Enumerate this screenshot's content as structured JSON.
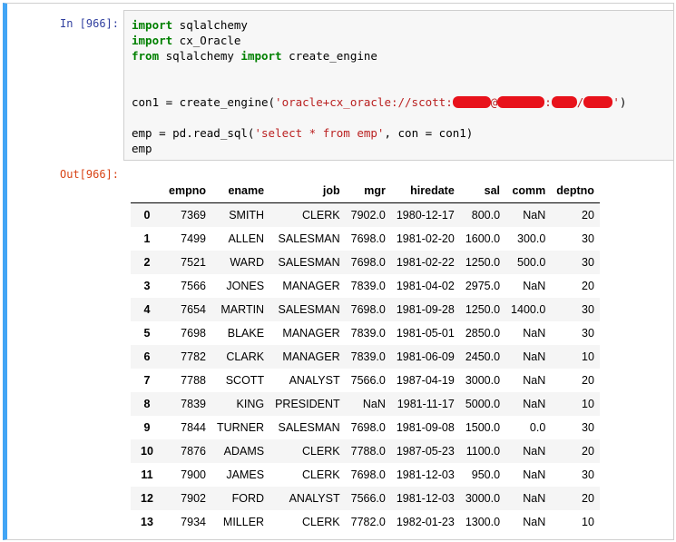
{
  "cell": {
    "in_prompt": "In [966]:",
    "out_prompt": "Out[966]:"
  },
  "code": {
    "l1_kw": "import",
    "l1_rest": " sqlalchemy",
    "l2_kw": "import",
    "l2_rest": " cx_Oracle",
    "l3_kw1": "from",
    "l3_mid": " sqlalchemy ",
    "l3_kw2": "import",
    "l3_rest": " create_engine",
    "l4_pre": "con1 = create_engine(",
    "l4_str1": "'oracle+cx_oracle://scott:",
    "l4_str2": "@",
    "l4_str3": ":",
    "l4_str4": "/",
    "l4_str5": "'",
    "l4_post": ")",
    "l5_pre": "emp = pd.read_sql(",
    "l5_str": "'select * from emp'",
    "l5_post": ", con = con1)",
    "l6": "emp"
  },
  "table": {
    "columns": [
      "",
      "empno",
      "ename",
      "job",
      "mgr",
      "hiredate",
      "sal",
      "comm",
      "deptno"
    ],
    "rows": [
      [
        "0",
        "7369",
        "SMITH",
        "CLERK",
        "7902.0",
        "1980-12-17",
        "800.0",
        "NaN",
        "20"
      ],
      [
        "1",
        "7499",
        "ALLEN",
        "SALESMAN",
        "7698.0",
        "1981-02-20",
        "1600.0",
        "300.0",
        "30"
      ],
      [
        "2",
        "7521",
        "WARD",
        "SALESMAN",
        "7698.0",
        "1981-02-22",
        "1250.0",
        "500.0",
        "30"
      ],
      [
        "3",
        "7566",
        "JONES",
        "MANAGER",
        "7839.0",
        "1981-04-02",
        "2975.0",
        "NaN",
        "20"
      ],
      [
        "4",
        "7654",
        "MARTIN",
        "SALESMAN",
        "7698.0",
        "1981-09-28",
        "1250.0",
        "1400.0",
        "30"
      ],
      [
        "5",
        "7698",
        "BLAKE",
        "MANAGER",
        "7839.0",
        "1981-05-01",
        "2850.0",
        "NaN",
        "30"
      ],
      [
        "6",
        "7782",
        "CLARK",
        "MANAGER",
        "7839.0",
        "1981-06-09",
        "2450.0",
        "NaN",
        "10"
      ],
      [
        "7",
        "7788",
        "SCOTT",
        "ANALYST",
        "7566.0",
        "1987-04-19",
        "3000.0",
        "NaN",
        "20"
      ],
      [
        "8",
        "7839",
        "KING",
        "PRESIDENT",
        "NaN",
        "1981-11-17",
        "5000.0",
        "NaN",
        "10"
      ],
      [
        "9",
        "7844",
        "TURNER",
        "SALESMAN",
        "7698.0",
        "1981-09-08",
        "1500.0",
        "0.0",
        "30"
      ],
      [
        "10",
        "7876",
        "ADAMS",
        "CLERK",
        "7788.0",
        "1987-05-23",
        "1100.0",
        "NaN",
        "20"
      ],
      [
        "11",
        "7900",
        "JAMES",
        "CLERK",
        "7698.0",
        "1981-12-03",
        "950.0",
        "NaN",
        "30"
      ],
      [
        "12",
        "7902",
        "FORD",
        "ANALYST",
        "7566.0",
        "1981-12-03",
        "3000.0",
        "NaN",
        "20"
      ],
      [
        "13",
        "7934",
        "MILLER",
        "CLERK",
        "7782.0",
        "1982-01-23",
        "1300.0",
        "NaN",
        "10"
      ]
    ]
  },
  "colors": {
    "cell_border_active": "#42a5f5",
    "in_prompt": "#303f9f",
    "out_prompt": "#d84315",
    "keyword": "#008000",
    "string": "#ba2121",
    "redaction": "#e8121b"
  }
}
